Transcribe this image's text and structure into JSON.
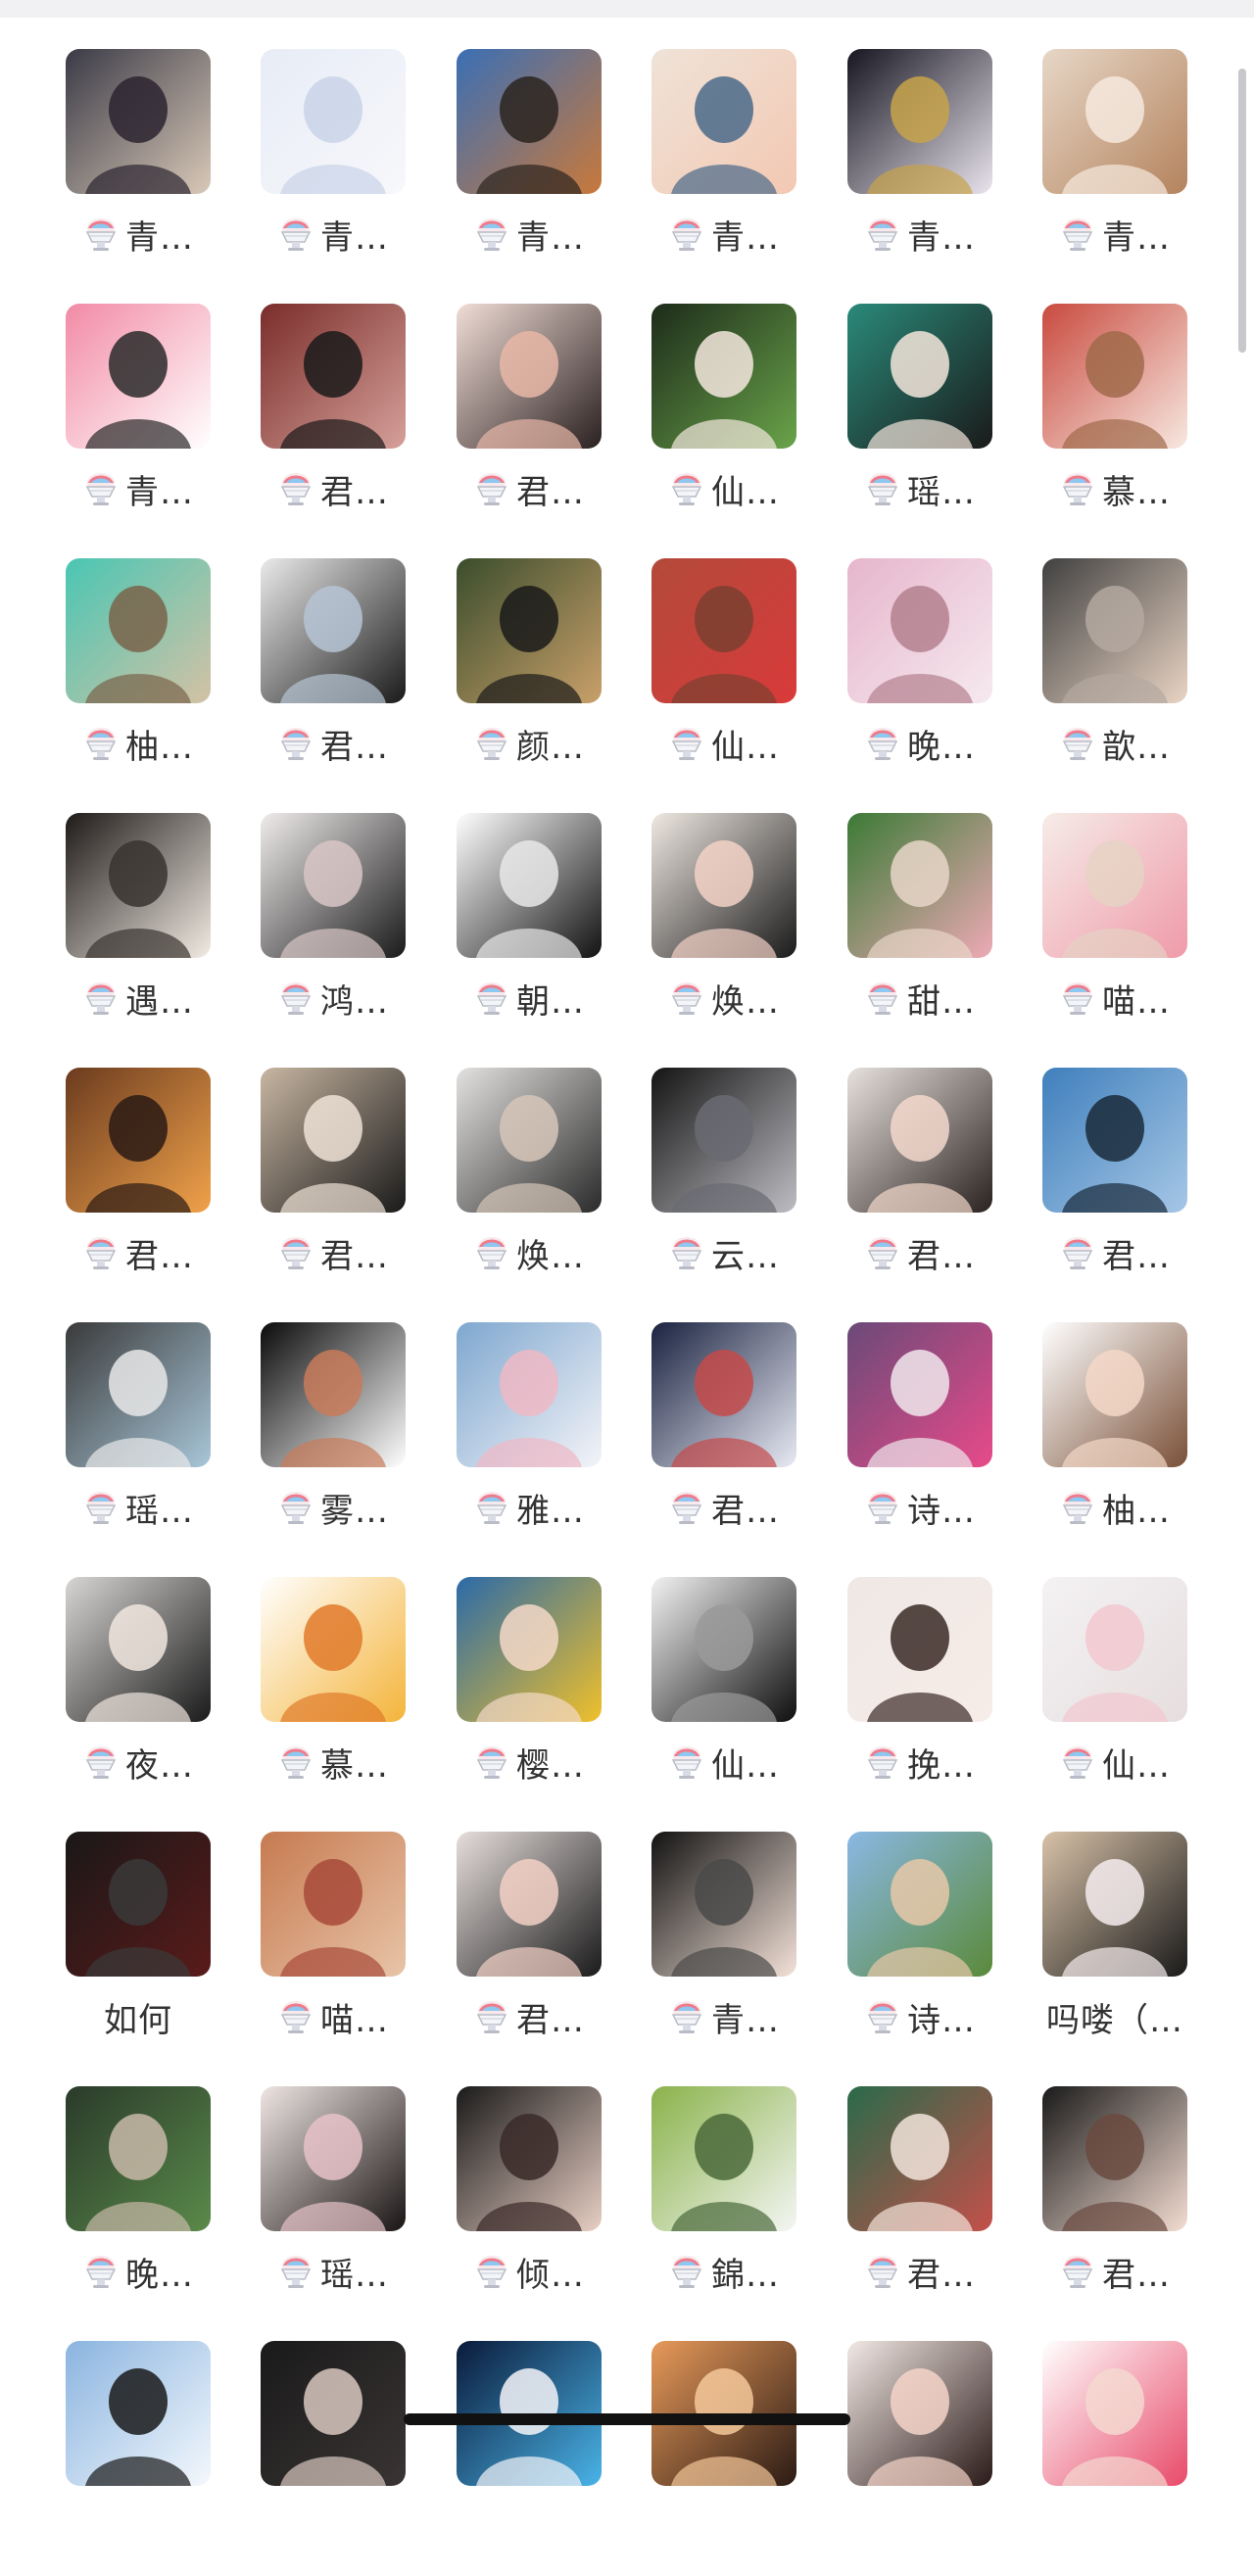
{
  "grid": {
    "rows": [
      [
        {
          "label": "青…",
          "icon": true,
          "palette": [
            "#3a3a46",
            "#d9c9b8",
            "#2b2530"
          ]
        },
        {
          "label": "青…",
          "icon": true,
          "palette": [
            "#e7ecf6",
            "#f8f8fb",
            "#c9d3e8"
          ]
        },
        {
          "label": "青…",
          "icon": true,
          "palette": [
            "#3a6fb6",
            "#c9793a",
            "#2b2420"
          ]
        },
        {
          "label": "青…",
          "icon": true,
          "palette": [
            "#efe3d8",
            "#f3c8b2",
            "#4a6a8a"
          ]
        },
        {
          "label": "青…",
          "icon": true,
          "palette": [
            "#161520",
            "#e9e4ee",
            "#c7a34a"
          ]
        },
        {
          "label": "青…",
          "icon": true,
          "palette": [
            "#e7d7c7",
            "#b4835d",
            "#f6e9de"
          ]
        }
      ],
      [
        {
          "label": "青…",
          "icon": true,
          "palette": [
            "#f28aa5",
            "#ffffff",
            "#2a2a2a"
          ]
        },
        {
          "label": "君…",
          "icon": true,
          "palette": [
            "#7a2d2a",
            "#d6a09a",
            "#1a1a1a"
          ]
        },
        {
          "label": "君…",
          "icon": true,
          "palette": [
            "#f1ddd6",
            "#2a2020",
            "#e7b7a7"
          ]
        },
        {
          "label": "仙…",
          "icon": true,
          "palette": [
            "#1d2b1a",
            "#6aa44a",
            "#f4e8de"
          ]
        },
        {
          "label": "瑶…",
          "icon": true,
          "palette": [
            "#2a8a7a",
            "#1a1a1a",
            "#f4e6dc"
          ]
        },
        {
          "label": "慕…",
          "icon": true,
          "palette": [
            "#c94a3f",
            "#f7e8e0",
            "#a06a4a"
          ]
        }
      ],
      [
        {
          "label": "柚…",
          "icon": true,
          "palette": [
            "#49c6b3",
            "#d4c2a5",
            "#79644a"
          ]
        },
        {
          "label": "君…",
          "icon": true,
          "palette": [
            "#eaeaea",
            "#1a1a1a",
            "#b6c4d4"
          ]
        },
        {
          "label": "颜…",
          "icon": true,
          "palette": [
            "#3a4d2c",
            "#c9a06a",
            "#1a1a1a"
          ]
        },
        {
          "label": "仙…",
          "icon": true,
          "palette": [
            "#b24a3a",
            "#d93a3a",
            "#7a4030"
          ]
        },
        {
          "label": "晚…",
          "icon": true,
          "palette": [
            "#e6b6cc",
            "#f6e9ef",
            "#b4808e"
          ]
        },
        {
          "label": "歆…",
          "icon": true,
          "palette": [
            "#404040",
            "#e9d4c4",
            "#b4a8a0"
          ]
        }
      ],
      [
        {
          "label": "遇…",
          "icon": true,
          "palette": [
            "#1e1a18",
            "#f2ebe3",
            "#3a3430"
          ]
        },
        {
          "label": "鸿…",
          "icon": true,
          "palette": [
            "#f0ecec",
            "#1a1a1a",
            "#d8c6c6"
          ]
        },
        {
          "label": "朝…",
          "icon": true,
          "palette": [
            "#ffffff",
            "#121212",
            "#e8e8e8"
          ]
        },
        {
          "label": "焕…",
          "icon": true,
          "palette": [
            "#efe8e2",
            "#1a1a1a",
            "#f3d2c6"
          ]
        },
        {
          "label": "甜…",
          "icon": true,
          "palette": [
            "#3b7a35",
            "#eeaab6",
            "#e8d6c8"
          ]
        },
        {
          "label": "喵…",
          "icon": true,
          "palette": [
            "#f6ece8",
            "#ef9aa9",
            "#e6d2c4"
          ]
        }
      ],
      [
        {
          "label": "君…",
          "icon": true,
          "palette": [
            "#6b3b1f",
            "#f0a24a",
            "#2a1a14"
          ]
        },
        {
          "label": "君…",
          "icon": true,
          "palette": [
            "#c8b6a2",
            "#1a1a1a",
            "#efe2d6"
          ]
        },
        {
          "label": "焕…",
          "icon": true,
          "palette": [
            "#e4e2e0",
            "#2a2a2a",
            "#d6c6b8"
          ]
        },
        {
          "label": "云…",
          "icon": true,
          "palette": [
            "#141414",
            "#bdbdc3",
            "#6a6a72"
          ]
        },
        {
          "label": "君…",
          "icon": true,
          "palette": [
            "#e8e2de",
            "#2a2220",
            "#f3d8cc"
          ]
        },
        {
          "label": "君…",
          "icon": true,
          "palette": [
            "#3f7fbc",
            "#a6c7e6",
            "#1a2a3a"
          ]
        }
      ],
      [
        {
          "label": "瑶…",
          "icon": true,
          "palette": [
            "#3a3a3a",
            "#a8c6d8",
            "#e8e8e8"
          ]
        },
        {
          "label": "雾…",
          "icon": true,
          "palette": [
            "#0a0a0a",
            "#ffffff",
            "#c87a5a"
          ]
        },
        {
          "label": "雅…",
          "icon": true,
          "palette": [
            "#7ea7cf",
            "#f4f4f8",
            "#f0b8c4"
          ]
        },
        {
          "label": "君…",
          "icon": true,
          "palette": [
            "#1a2240",
            "#e8eaf4",
            "#c44a4a"
          ]
        },
        {
          "label": "诗…",
          "icon": true,
          "palette": [
            "#6a4a78",
            "#e84a8a",
            "#f0e8ec"
          ]
        },
        {
          "label": "柚…",
          "icon": true,
          "palette": [
            "#ffffff",
            "#7a5038",
            "#f4d8c8"
          ]
        }
      ],
      [
        {
          "label": "夜…",
          "icon": true,
          "palette": [
            "#d8d6d4",
            "#1a1a1a",
            "#f0e6de"
          ]
        },
        {
          "label": "慕…",
          "icon": true,
          "palette": [
            "#ffffff",
            "#f4b43a",
            "#e07a2a"
          ]
        },
        {
          "label": "樱…",
          "icon": true,
          "palette": [
            "#2a6aa8",
            "#f0c02a",
            "#f4d8c8"
          ]
        },
        {
          "label": "仙…",
          "icon": true,
          "palette": [
            "#f2f2f2",
            "#0e0e0e",
            "#9a9a9a"
          ]
        },
        {
          "label": "挽…",
          "icon": true,
          "palette": [
            "#efe8e4",
            "#f6ece8",
            "#3a2a26"
          ]
        },
        {
          "label": "仙…",
          "icon": true,
          "palette": [
            "#f4f2f4",
            "#e6dede",
            "#f2c8d0"
          ]
        }
      ],
      [
        {
          "label": "如何",
          "icon": false,
          "palette": [
            "#1a1818",
            "#5a1a1a",
            "#3a3a3a"
          ]
        },
        {
          "label": "喵…",
          "icon": true,
          "palette": [
            "#c67a50",
            "#e8c4a8",
            "#a84a3a"
          ]
        },
        {
          "label": "君…",
          "icon": true,
          "palette": [
            "#e6dedc",
            "#1a1a1a",
            "#f2d0c4"
          ]
        },
        {
          "label": "青…",
          "icon": true,
          "palette": [
            "#121212",
            "#f4e2d8",
            "#4a4a4a"
          ]
        },
        {
          "label": "诗…",
          "icon": true,
          "palette": [
            "#8ab8e4",
            "#5a8a3a",
            "#e8c8a8"
          ]
        },
        {
          "label": "吗喽（…",
          "icon": false,
          "palette": [
            "#d8c2a8",
            "#1a1a1a",
            "#f6ecee"
          ]
        }
      ],
      [
        {
          "label": "晚…",
          "icon": true,
          "palette": [
            "#2a3a2a",
            "#5a8a4a",
            "#c8b8a8"
          ]
        },
        {
          "label": "瑶…",
          "icon": true,
          "palette": [
            "#efe6e4",
            "#1a1414",
            "#e6c2c8"
          ]
        },
        {
          "label": "倾…",
          "icon": true,
          "palette": [
            "#1a1a1a",
            "#e8cfc4",
            "#3a2a28"
          ]
        },
        {
          "label": "錦…",
          "icon": true,
          "palette": [
            "#8ab24a",
            "#f4f6f4",
            "#4a6a3a"
          ]
        },
        {
          "label": "君…",
          "icon": true,
          "palette": [
            "#2a6a4a",
            "#c4504a",
            "#f2e4da"
          ]
        },
        {
          "label": "君…",
          "icon": true,
          "palette": [
            "#1a1a1a",
            "#f4ddd2",
            "#6a4a40"
          ]
        }
      ],
      [
        {
          "label": "",
          "icon": false,
          "palette": [
            "#8ab4e0",
            "#f4f8fc",
            "#1a1a1a"
          ]
        },
        {
          "label": "",
          "icon": false,
          "palette": [
            "#1a1a1a",
            "#3a3434",
            "#d8c8c0"
          ]
        },
        {
          "label": "",
          "icon": false,
          "palette": [
            "#0a1a3a",
            "#4ab4e8",
            "#f4f4f8"
          ]
        },
        {
          "label": "",
          "icon": false,
          "palette": [
            "#e89a5a",
            "#2a1a14",
            "#f4c89a"
          ]
        },
        {
          "label": "",
          "icon": false,
          "palette": [
            "#f2e8e4",
            "#2a1a18",
            "#f4d4c8"
          ]
        },
        {
          "label": "",
          "icon": false,
          "palette": [
            "#ffffff",
            "#e84a6a",
            "#f4d8d0"
          ]
        }
      ]
    ]
  },
  "icons": {
    "label_icon": "shaved-ice-icon"
  },
  "colors": {
    "text": "#333333",
    "background": "#ffffff",
    "scrollbar": "#c8c8cc",
    "home_indicator": "#111111"
  }
}
